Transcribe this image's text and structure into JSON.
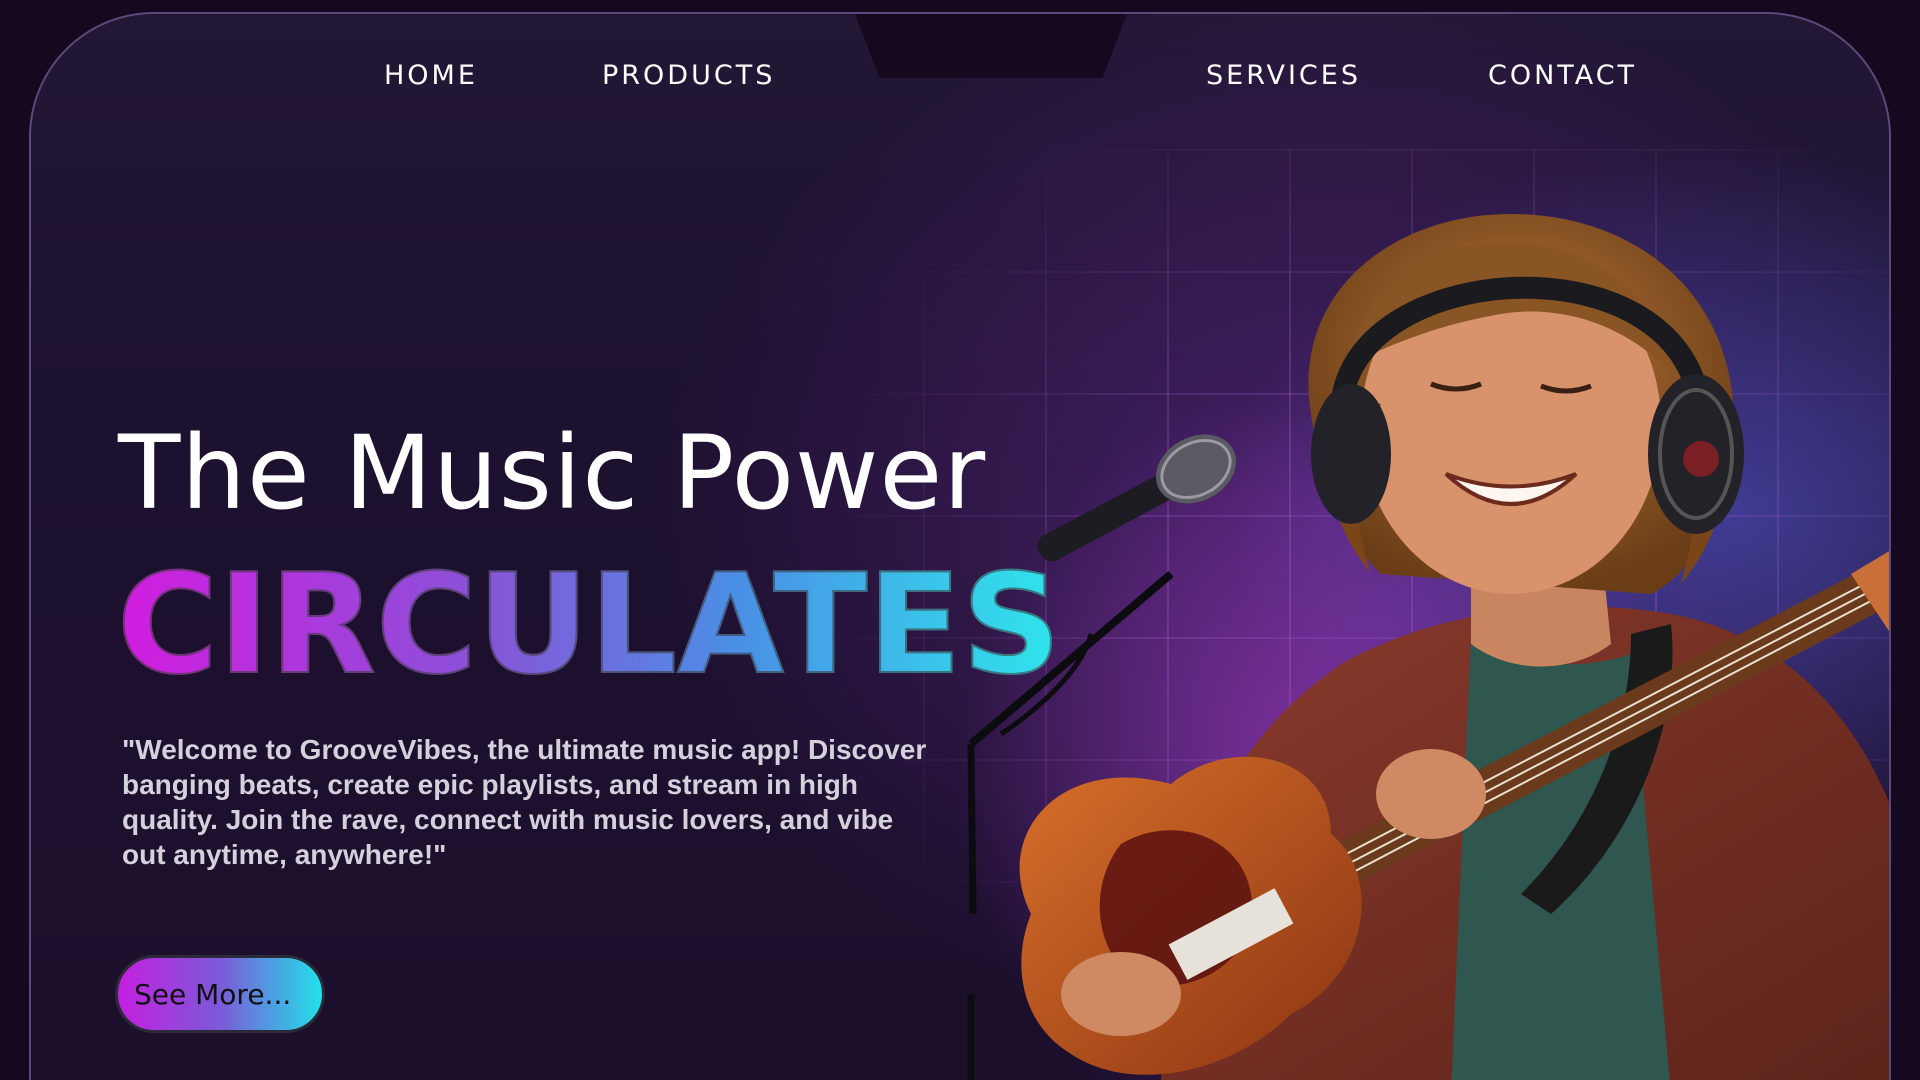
{
  "nav": {
    "items": [
      {
        "label": "HOME"
      },
      {
        "label": "PRODUCTS"
      },
      {
        "label": "SERVICES"
      },
      {
        "label": "CONTACT"
      }
    ]
  },
  "hero": {
    "title": "The Music Power",
    "subtitle": "CIRCULATES",
    "description": "\"Welcome to GrooveVibes, the ultimate music app! Discover banging beats, create epic playlists, and stream in high quality. Join the rave, connect with music lovers, and vibe out anytime, anywhere!\"",
    "cta_label": "See More..."
  },
  "image": {
    "icon": "musician-with-guitar-and-microphone"
  },
  "colors": {
    "background": "#1b0f2c",
    "accent_magenta": "#d21ce0",
    "accent_cyan": "#2fe6ec",
    "glow_purple": "#be46e6"
  }
}
